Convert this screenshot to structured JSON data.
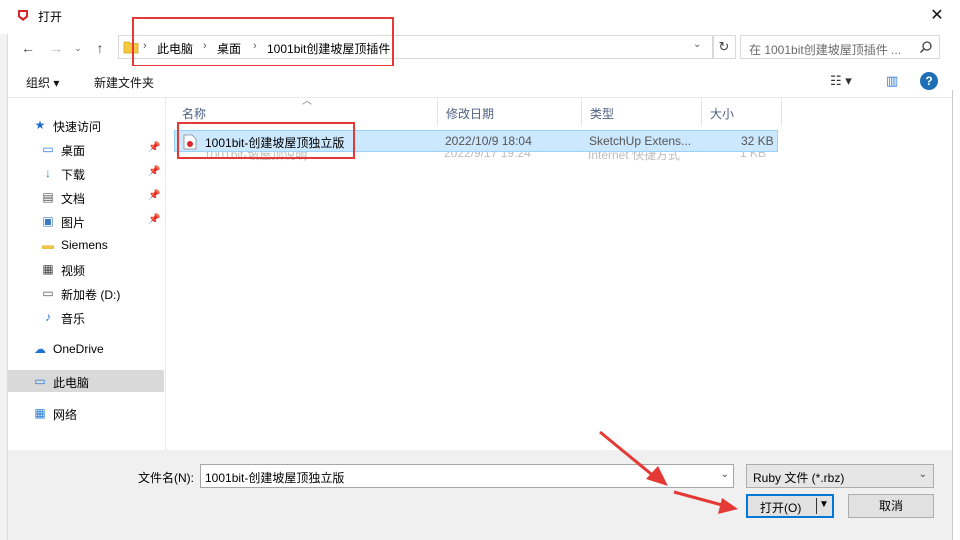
{
  "window": {
    "title": "打开",
    "close_glyph": "✕"
  },
  "nav": {
    "back": "←",
    "forward": "→",
    "recent": "⌄",
    "up": "↑",
    "dropdown": "⌄",
    "refresh": "↻"
  },
  "breadcrumbs": [
    {
      "sep": "›",
      "label": "此电脑"
    },
    {
      "sep": "›",
      "label": "桌面"
    },
    {
      "sep": "›",
      "label": "1001bit创建坡屋顶插件"
    }
  ],
  "search": {
    "placeholder": "在 1001bit创建坡屋顶插件 ..."
  },
  "toolbar": {
    "organize": "组织 ▾",
    "new_folder": "新建文件夹",
    "view_menu": "☷ ▾",
    "preview_pane": "▥",
    "help": "?"
  },
  "sidebar": {
    "items": [
      {
        "label": "快速访问",
        "icon": "star-icon",
        "glyph": "★",
        "color": "#1e6fd0"
      },
      {
        "label": "桌面",
        "icon": "desktop-icon",
        "glyph": "▭",
        "color": "#2b7cd3",
        "pinned": true
      },
      {
        "label": "下载",
        "icon": "download-icon",
        "glyph": "↓",
        "color": "#2b7cd3",
        "pinned": true
      },
      {
        "label": "文档",
        "icon": "document-icon",
        "glyph": "▤",
        "color": "#555",
        "pinned": true
      },
      {
        "label": "图片",
        "icon": "picture-icon",
        "glyph": "▣",
        "color": "#3a7bbf",
        "pinned": true
      },
      {
        "label": "Siemens",
        "icon": "folder-icon",
        "glyph": "▬",
        "color": "#f0c24b"
      },
      {
        "label": "视频",
        "icon": "video-icon",
        "glyph": "▦",
        "color": "#444"
      },
      {
        "label": "新加卷 (D:)",
        "icon": "drive-icon",
        "glyph": "▭",
        "color": "#555"
      },
      {
        "label": "音乐",
        "icon": "music-icon",
        "glyph": "♪",
        "color": "#2b7cd3"
      },
      {
        "label": "OneDrive",
        "icon": "cloud-icon",
        "glyph": "☁",
        "color": "#1c73d1"
      },
      {
        "label": "此电脑",
        "icon": "computer-icon",
        "glyph": "▭",
        "color": "#2b7cd3",
        "selected": true
      },
      {
        "label": "网络",
        "icon": "network-icon",
        "glyph": "▦",
        "color": "#2b7cd3"
      }
    ],
    "pin_glyph": "📌"
  },
  "columns": {
    "name": "名称",
    "modified": "修改日期",
    "type": "类型",
    "size": "大小"
  },
  "files": [
    {
      "name": "1001bit-创建坡屋顶独立版",
      "modified": "2022/10/9 18:04",
      "type": "SketchUp Extens...",
      "size": "32 KB",
      "selected": true
    },
    {
      "name": "1001bit-坡屋顶说明",
      "modified": "2022/9/17 19:24",
      "type": "Internet 快捷方式",
      "size": "1 KB",
      "selected": false
    }
  ],
  "bottom": {
    "filename_label": "文件名(N):",
    "filename_value": "1001bit-创建坡屋顶独立版",
    "filter_value": "Ruby 文件 (*.rbz)",
    "open_label": "打开(O)",
    "cancel_label": "取消"
  },
  "colors": {
    "annotation_red": "#e53935",
    "selection_blue": "#cce8ff",
    "accent": "#0078d7"
  }
}
